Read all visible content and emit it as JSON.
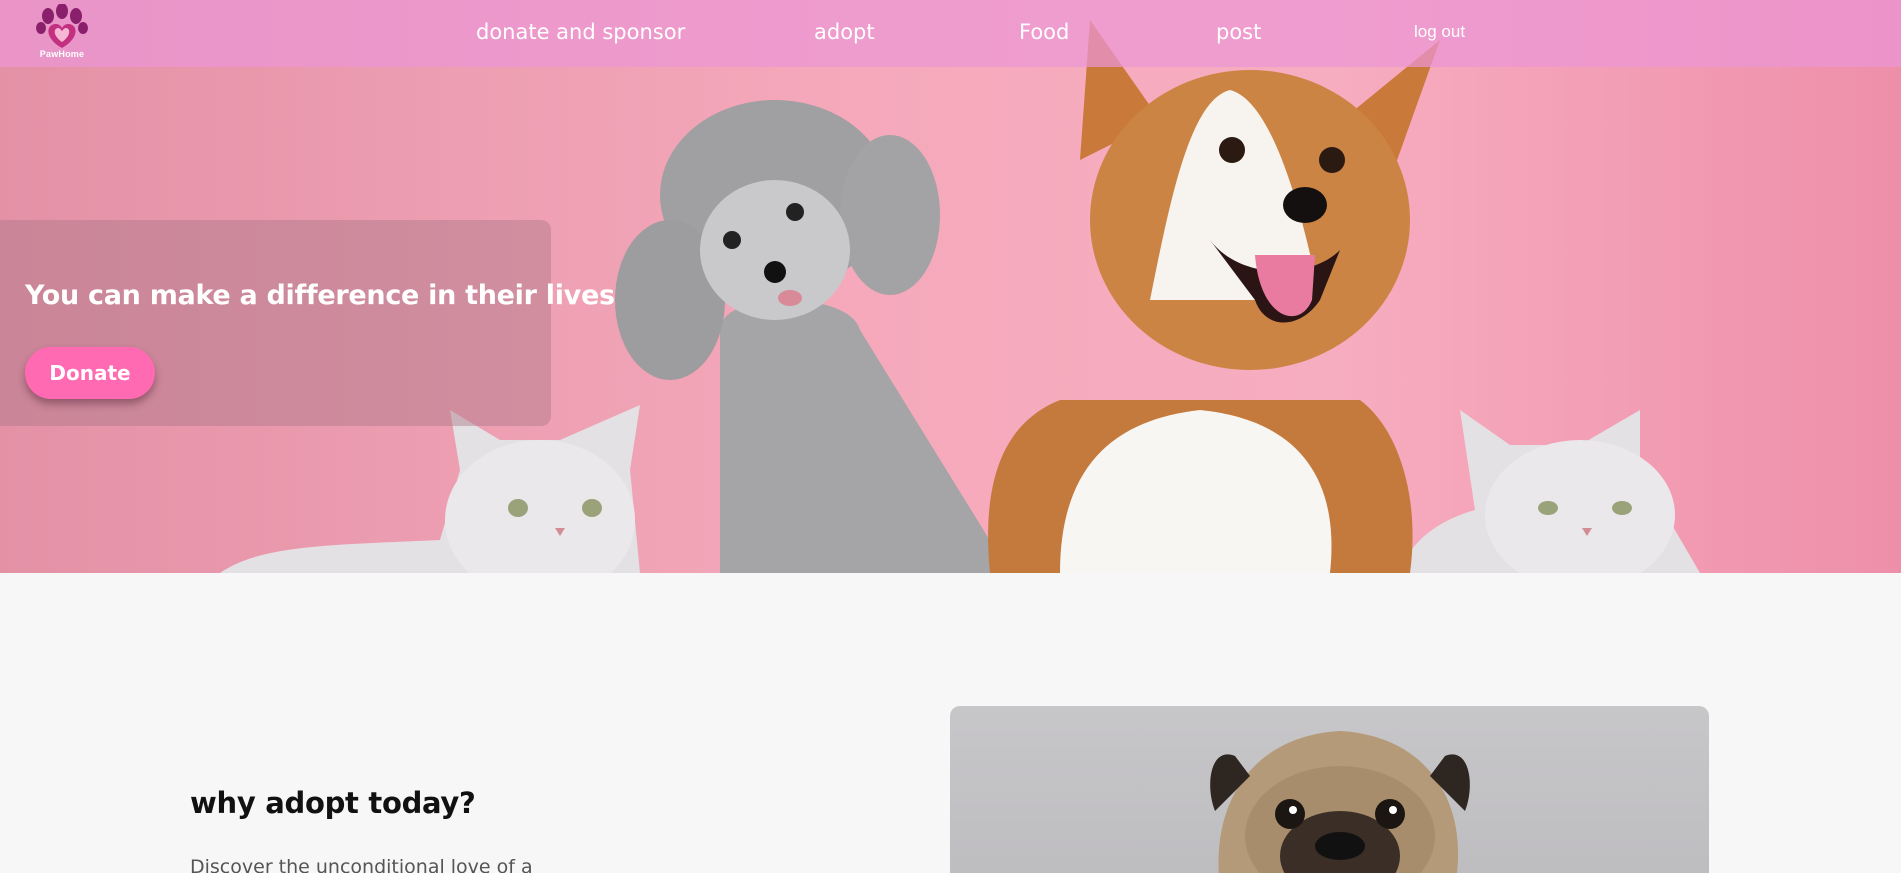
{
  "brand": {
    "logo_text": "PawHome"
  },
  "nav": {
    "links": [
      {
        "label": "donate and sponsor"
      },
      {
        "label": "adopt"
      },
      {
        "label": "Food"
      },
      {
        "label": "post"
      }
    ],
    "logout_label": "log out"
  },
  "hero": {
    "title": "You can make a difference in their lives",
    "donate_label": "Donate"
  },
  "section": {
    "title": "why adopt today?",
    "text": "Discover the unconditional love of a"
  },
  "colors": {
    "nav_bg": "#ec96d6",
    "hero_bg": "#f5a9bb",
    "accent_button": "#ff6ab2",
    "page_bg": "#f7f7f7"
  },
  "icons": {
    "logo": "paw-heart-icon"
  }
}
